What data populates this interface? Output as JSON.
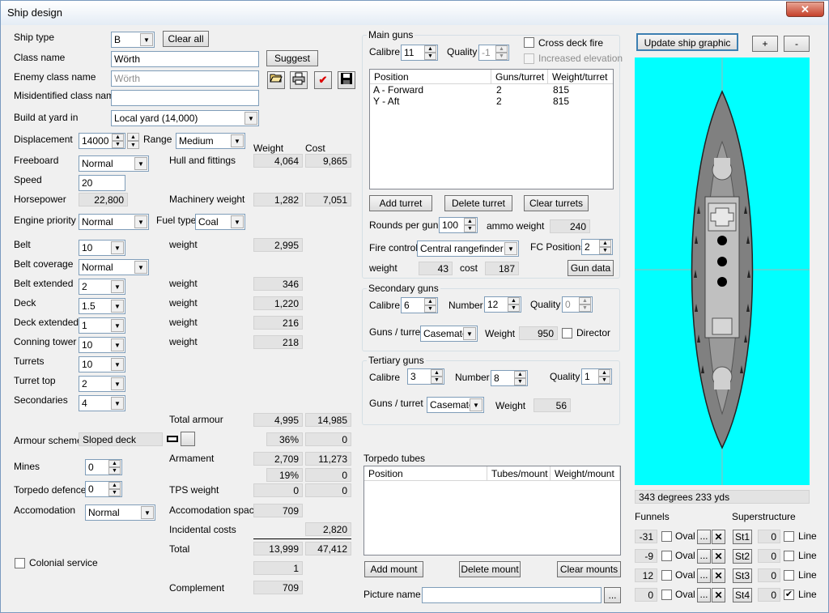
{
  "window": {
    "title": "Ship design",
    "close": "✕"
  },
  "left": {
    "ship_type": {
      "label": "Ship type",
      "value": "B"
    },
    "clear_all": "Clear all",
    "class_name": {
      "label": "Class name",
      "value": "Wörth"
    },
    "suggest": "Suggest",
    "enemy_class_name": {
      "label": "Enemy class name",
      "value": "Wörth"
    },
    "misidentified": {
      "label": "Misidentified class name",
      "value": ""
    },
    "build_yard": {
      "label": "Build at yard in",
      "value": "Local yard (14,000)"
    },
    "displacement": {
      "label": "Displacement",
      "value": "14000"
    },
    "range": {
      "label": "Range",
      "value": "Medium"
    },
    "headers": {
      "weight": "Weight",
      "cost": "Cost"
    },
    "freeboard": {
      "label": "Freeboard",
      "value": "Normal"
    },
    "hull": {
      "label": "Hull and fittings",
      "weight": "4,064",
      "cost": "9,865"
    },
    "speed": {
      "label": "Speed",
      "value": "20"
    },
    "horsepower": {
      "label": "Horsepower",
      "value": "22,800"
    },
    "machinery": {
      "label": "Machinery weight",
      "weight": "1,282",
      "cost": "7,051"
    },
    "engine_priority": {
      "label": "Engine priority",
      "value": "Normal"
    },
    "fuel_type": {
      "label": "Fuel type",
      "value": "Coal"
    },
    "belt": {
      "label": "Belt",
      "value": "10",
      "wlabel": "weight",
      "weight": "2,995"
    },
    "belt_coverage": {
      "label": "Belt coverage",
      "value": "Normal"
    },
    "belt_extended": {
      "label": "Belt extended",
      "value": "2",
      "wlabel": "weight",
      "weight": "346"
    },
    "deck": {
      "label": "Deck",
      "value": "1.5",
      "wlabel": "weight",
      "weight": "1,220"
    },
    "deck_extended": {
      "label": "Deck extended",
      "value": "1",
      "wlabel": "weight",
      "weight": "216"
    },
    "conning_tower": {
      "label": "Conning tower",
      "value": "10",
      "wlabel": "weight",
      "weight": "218"
    },
    "turrets": {
      "label": "Turrets",
      "value": "10"
    },
    "turret_top": {
      "label": "Turret top",
      "value": "2"
    },
    "secondaries": {
      "label": "Secondaries",
      "value": "4"
    },
    "total_armour": {
      "label": "Total armour",
      "weight": "4,995",
      "cost": "14,985"
    },
    "armour_scheme": {
      "label": "Armour scheme",
      "value": "Sloped deck",
      "pct": "36%",
      "cost": "0"
    },
    "armament": {
      "label": "Armament",
      "weight": "2,709",
      "cost": "11,273",
      "pct": "19%",
      "cost2": "0"
    },
    "mines": {
      "label": "Mines",
      "value": "0"
    },
    "torpedo_defence": {
      "label": "Torpedo defence",
      "value": "0"
    },
    "tps_weight": {
      "label": "TPS weight",
      "weight": "0",
      "cost": "0"
    },
    "accomodation": {
      "label": "Accomodation",
      "value": "Normal"
    },
    "accomodation_space": {
      "label": "Accomodation space",
      "value": "709"
    },
    "incidental": {
      "label": "Incidental costs",
      "value": "2,820"
    },
    "total": {
      "label": "Total",
      "weight": "13,999",
      "cost": "47,412"
    },
    "colonial": {
      "label": "Colonial service",
      "value": "1"
    },
    "complement": {
      "label": "Complement",
      "value": "709"
    }
  },
  "main_guns": {
    "title": "Main guns",
    "calibre_label": "Calibre",
    "calibre": "11",
    "quality_label": "Quality",
    "quality": "-1",
    "cross_deck": "Cross deck fire",
    "increased_elev": "Increased elevation",
    "columns": [
      "Position",
      "Guns/turret",
      "Weight/turret"
    ],
    "rows": [
      [
        "A - Forward",
        "2",
        "815"
      ],
      [
        "Y - Aft",
        "2",
        "815"
      ]
    ],
    "add_turret": "Add turret",
    "delete_turret": "Delete turret",
    "clear_turrets": "Clear turrets",
    "rounds_label": "Rounds per gun",
    "rounds": "100",
    "ammo_label": "ammo weight",
    "ammo": "240",
    "fire_control_label": "Fire control",
    "fire_control": "Central rangefinder",
    "fc_positions_label": "FC Positions",
    "fc_positions": "2",
    "weight_label": "weight",
    "weight": "43",
    "cost_label": "cost",
    "cost": "187",
    "gun_data": "Gun data"
  },
  "secondary_guns": {
    "title": "Secondary guns",
    "calibre_label": "Calibre",
    "calibre": "6",
    "number_label": "Number",
    "number": "12",
    "quality_label": "Quality",
    "quality": "0",
    "guns_turret_label": "Guns / turret",
    "guns_turret": "Casemate",
    "weight_label": "Weight",
    "weight": "950",
    "director": "Director"
  },
  "tertiary_guns": {
    "title": "Tertiary guns",
    "calibre_label": "Calibre",
    "calibre": "3",
    "number_label": "Number",
    "number": "8",
    "quality_label": "Quality",
    "quality": "1",
    "guns_turret_label": "Guns / turret",
    "guns_turret": "Casemate",
    "weight_label": "Weight",
    "weight": "56"
  },
  "torpedo": {
    "title": "Torpedo tubes",
    "columns": [
      "Position",
      "Tubes/mount",
      "Weight/mount"
    ],
    "add_mount": "Add mount",
    "delete_mount": "Delete mount",
    "clear_mounts": "Clear mounts",
    "picture_label": "Picture name",
    "picture": "",
    "browse": "..."
  },
  "graphic": {
    "update": "Update ship graphic",
    "plus": "+",
    "minus": "-",
    "status": "343 degrees 233 yds",
    "bg_color": "#00ffff",
    "funnels_label": "Funnels",
    "superstructure_label": "Superstructure",
    "funnels": [
      {
        "value": "-31",
        "oval": "Oval",
        "st": "St1",
        "sv": "0",
        "line": "Line",
        "line_checked": false
      },
      {
        "value": "-9",
        "oval": "Oval",
        "st": "St2",
        "sv": "0",
        "line": "Line",
        "line_checked": false
      },
      {
        "value": "12",
        "oval": "Oval",
        "st": "St3",
        "sv": "0",
        "line": "Line",
        "line_checked": false
      },
      {
        "value": "0",
        "oval": "Oval",
        "st": "St4",
        "sv": "0",
        "line": "Line",
        "line_checked": true
      }
    ],
    "dots": "...",
    "x": "✕",
    "check": "✔"
  }
}
